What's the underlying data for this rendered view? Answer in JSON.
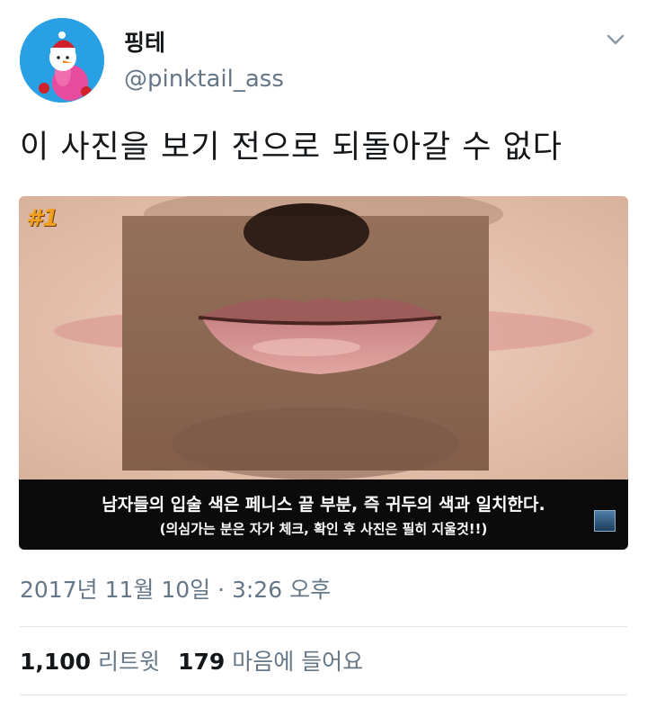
{
  "author": {
    "display_name": "핑테",
    "handle": "@pinktail_ass"
  },
  "tweet": {
    "text": "이 사진을 보기 전으로 되돌아갈 수 없다",
    "timestamp": "2017년 11월 10일 · 3:26 오후"
  },
  "media": {
    "badge": "#1",
    "caption_line1": "남자들의 입술 색은 페니스 끝 부분, 즉 귀두의 색과 일치한다.",
    "caption_line2": "(의심가는 분은 자가 체크, 확인 후 사진은 필히 지울것!!)"
  },
  "stats": {
    "retweets_count": "1,100",
    "retweets_label": "리트윗",
    "likes_count": "179",
    "likes_label": "마음에 들어요"
  },
  "icons": {
    "caret": "chevron-down-icon",
    "avatar": "avatar-snowman-flamingo"
  },
  "colors": {
    "avatar_bg": "#2aa0e4",
    "secondary_text": "#657786",
    "primary_text": "#14171a"
  }
}
